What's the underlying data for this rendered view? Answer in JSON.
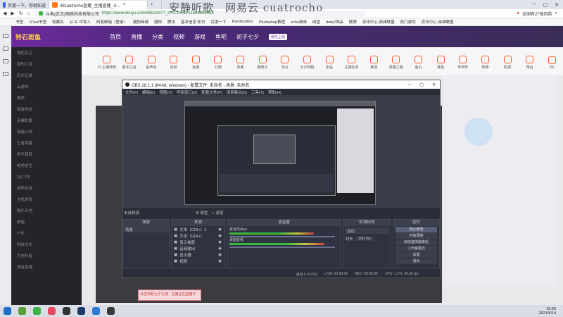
{
  "browser": {
    "tabs": [
      {
        "label": "百度一下，你就知道",
        "active": false
      },
      {
        "label": "48cuatrocho直播_主播直播_斗...",
        "active": true
      },
      {
        "label": "",
        "active": false
      }
    ],
    "new_tab": "+",
    "url": "https://www.douyu.com/6552287?_rt=3.2058751844865485",
    "site_name": "斗鱼(武汉)网络科技有限公司",
    "search_hint": "全国有27地风险",
    "bookmarks": [
      "书签",
      "1Paul书签",
      "收藏夹",
      "从 IE 中导入",
      "网易邮箱（登录）",
      "搜狗商城",
      "搜狗",
      "腾讯",
      "基本信息 知识",
      "百度一下",
      "PandoraBox",
      "Photoshop教程",
      "echo简单",
      "网盘",
      "dota2饰品",
      "微博",
      "资讯中心-英雄联盟",
      "热门游戏",
      "资讯中心-英雄联盟"
    ]
  },
  "watermark": "安静听歌　网易云 cuatrocho",
  "douyu": {
    "logo": "铃石斑鱼",
    "nav": [
      "首页",
      "直播",
      "分类",
      "视频",
      "游戏",
      "鱼吧",
      "初子七夕"
    ],
    "badge": "现已上线",
    "subnav": [
      "12 主播榜单",
      "勇夺之战",
      "鱼声音",
      "成就",
      "鱼塘",
      "打榜",
      "风暴",
      "翻牌子",
      "告白",
      "七夕特辑",
      "新品",
      "主播任务",
      "推送",
      "英雄之路",
      "鱼丸",
      "赛事",
      "世界杯",
      "热舞",
      "影视",
      "电台",
      "PK"
    ],
    "left_items": [
      "我的关注",
      "我的订阅",
      "历史记录",
      "云游戏",
      "推荐",
      "网游竞技",
      "英雄联盟",
      "穿越火线",
      "王者荣耀",
      "和平精英",
      "绝地求生",
      "QQ飞车",
      "单机热游",
      "主机游戏",
      "娱乐天地",
      "颜值",
      "户外",
      "科技文化",
      "文史科普",
      "语音直播"
    ],
    "promo": "点击领取七夕礼物 · 主播正在直播中"
  },
  "obs": {
    "title": "OBS 26.1.1 (64-bit, windows) - 配置文件: 未命名 - 场景: 未命名",
    "menu": [
      "文件(F)",
      "编辑(E)",
      "视图(V)",
      "停靠窗口(D)",
      "配置文件(P)",
      "场景集合(S)",
      "工具(T)",
      "帮助(H)"
    ],
    "no_source": "未选择源",
    "bar_buttons": [
      "属性",
      "滤镜"
    ],
    "docks": {
      "scenes": {
        "title": "场景",
        "items": [
          "场景"
        ]
      },
      "sources": {
        "title": "来源",
        "items": [
          "文本（GDI+）2",
          "文本（GDI+）",
          "显示捕获",
          "音频输出",
          "显示器",
          "视频"
        ]
      },
      "mixer": {
        "title": "混音器",
        "channels": [
          "麦克风/Aux",
          "桌面音频"
        ]
      },
      "transitions": {
        "title": "转场特效",
        "type": "淡出",
        "duration_label": "时长",
        "duration": "300 ms"
      },
      "controls": {
        "title": "控件",
        "buttons": [
          "停止推流",
          "开始录制",
          "启动虚拟摄像机",
          "工作室模式",
          "设置",
          "退出"
        ]
      }
    },
    "status": {
      "dropped": "丢帧 0 (0.0%)",
      "live": "LIVE: 00:00:00",
      "rec": "REC: 00:00:00",
      "cpu": "CPU: 1.1%, 60.00 fps"
    }
  },
  "taskbar": {
    "time": "15:59",
    "date": "2021/8/14"
  }
}
